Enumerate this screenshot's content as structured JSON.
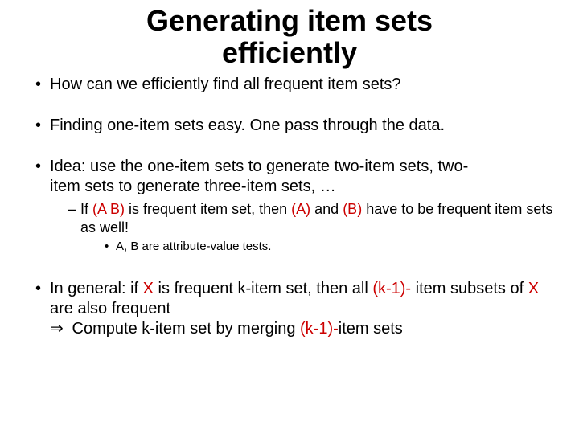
{
  "title_l1": "Generating item sets",
  "title_l2": "efficiently",
  "b1": "How can we efficiently find all frequent item sets?",
  "b2": "Finding one-item sets easy. One pass through the data.",
  "b3_a": "Idea: use the one-item sets to generate two-item sets, two-",
  "b3_b": "item sets to generate three-item sets, …",
  "b3s_a": "If ",
  "b3s_ab": "(A B)",
  "b3s_b": " is frequent item set, then ",
  "b3s_A": "(A)",
  "b3s_c": " and ",
  "b3s_B": "(B)",
  "b3s_d": " have to be frequent item sets as well!",
  "b3ss": "A, B are attribute-value tests.",
  "b4_a": "In general: if ",
  "b4_X1": "X",
  "b4_b": " is frequent k-item set, then all ",
  "b4_k1": "(k-1)-",
  "b4_c": " item subsets of ",
  "b4_X2": "X",
  "b4_d": " are also frequent",
  "b4_imp": "⇒",
  "b4_e": " Compute k-item set by merging ",
  "b4_k2": "(k-1)-",
  "b4_f": "item sets"
}
